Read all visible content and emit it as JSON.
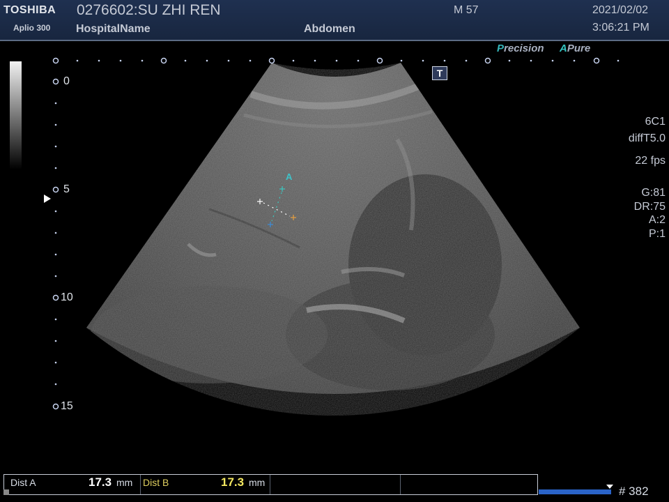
{
  "header": {
    "brand": "TOSHIBA",
    "model": "Aplio 300",
    "patient": "0276602:SU ZHI REN",
    "hospital": "HospitalName",
    "exam": "Abdomen",
    "sex_age": "M 57",
    "date": "2021/02/02",
    "time": "3:06:21 PM"
  },
  "image_modes": {
    "precision_p": "P",
    "precision_rest": "recision",
    "apure_a": "A",
    "apure_rest": "Pure"
  },
  "t_marker": "T",
  "params": {
    "probe": "6C1",
    "mode": "diffT5.0",
    "fps": "22 fps",
    "gain": "G:81",
    "dynamic_range": "DR:75",
    "a": "A:2",
    "p": "P:1"
  },
  "depth_scale": {
    "labels": [
      "0",
      "5",
      "10",
      "15"
    ]
  },
  "measurement_label": "A",
  "measurements": [
    {
      "name": "Dist A",
      "value": "17.3",
      "unit": "mm",
      "name_color": "#d8dde6",
      "value_color": "#ffffff"
    },
    {
      "name": "Dist B",
      "value": "17.3",
      "unit": "mm",
      "name_color": "#e0d060",
      "value_color": "#f5e860"
    }
  ],
  "cine": {
    "frame": "# 382"
  },
  "colors": {
    "header_bg": "#1f3050",
    "accent_cyan": "#34b4b8",
    "cine_blue": "#2a63c8"
  }
}
